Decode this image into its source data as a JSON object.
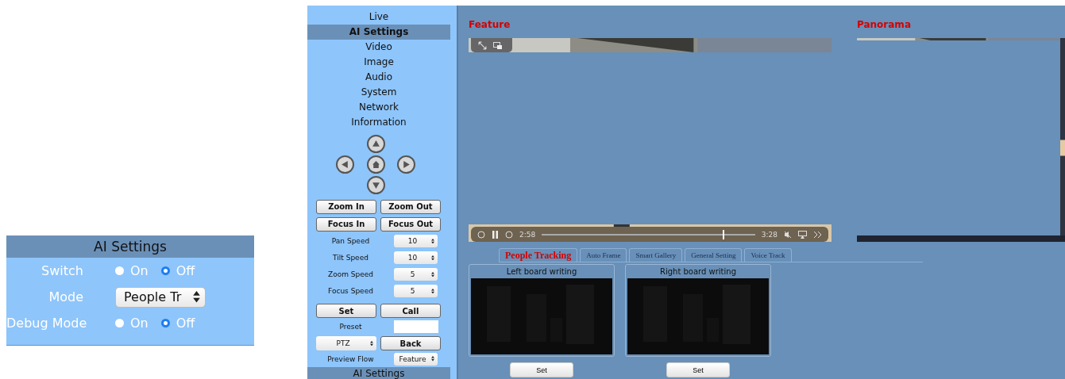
{
  "ai_settings_panel": {
    "title": "AI Settings",
    "rows": [
      {
        "kind": "radio",
        "label": "Switch",
        "options": [
          {
            "label": "On",
            "selected": false
          },
          {
            "label": "Off",
            "selected": true
          }
        ]
      },
      {
        "kind": "select",
        "label": "Mode",
        "value": "People Tr"
      },
      {
        "kind": "radio",
        "label": "Debug Mode",
        "options": [
          {
            "label": "On",
            "selected": false
          },
          {
            "label": "Off",
            "selected": true
          }
        ]
      }
    ]
  },
  "sidebar": {
    "menu": [
      {
        "label": "Live",
        "selected": false
      },
      {
        "label": "AI Settings",
        "selected": true
      },
      {
        "label": "Video",
        "selected": false
      },
      {
        "label": "Image",
        "selected": false
      },
      {
        "label": "Audio",
        "selected": false
      },
      {
        "label": "System",
        "selected": false
      },
      {
        "label": "Network",
        "selected": false
      },
      {
        "label": "Information",
        "selected": false
      }
    ],
    "button_rows": [
      [
        "Zoom In",
        "Zoom Out"
      ],
      [
        "Focus In",
        "Focus Out"
      ]
    ],
    "speeds": [
      {
        "label": "Pan Speed",
        "value": "10"
      },
      {
        "label": "Tilt Speed",
        "value": "10"
      },
      {
        "label": "Zoom Speed",
        "value": "5"
      },
      {
        "label": "Focus Speed",
        "value": "5"
      }
    ],
    "preset_buttons": [
      "Set",
      "Call"
    ],
    "preset_label": "Preset",
    "mode_select": "PTZ",
    "back_button": "Back",
    "preview_flow": {
      "label": "Preview Flow",
      "value": "Feature"
    },
    "footer": "AI Settings"
  },
  "feature": {
    "title": "Feature",
    "elapsed": "2:58",
    "total": "3:28",
    "level": 0.85
  },
  "panorama": {
    "title": "Panorama"
  },
  "tabs": [
    {
      "label": "People Tracking",
      "selected": true
    },
    {
      "label": "Auto Frame",
      "selected": false
    },
    {
      "label": "Smart Gallery",
      "selected": false
    },
    {
      "label": "General Setting",
      "selected": false
    },
    {
      "label": "Voice Track",
      "selected": false
    }
  ],
  "boards": [
    {
      "title": "Left board writing",
      "button": "Set"
    },
    {
      "title": "Right board writing",
      "button": "Set"
    }
  ]
}
